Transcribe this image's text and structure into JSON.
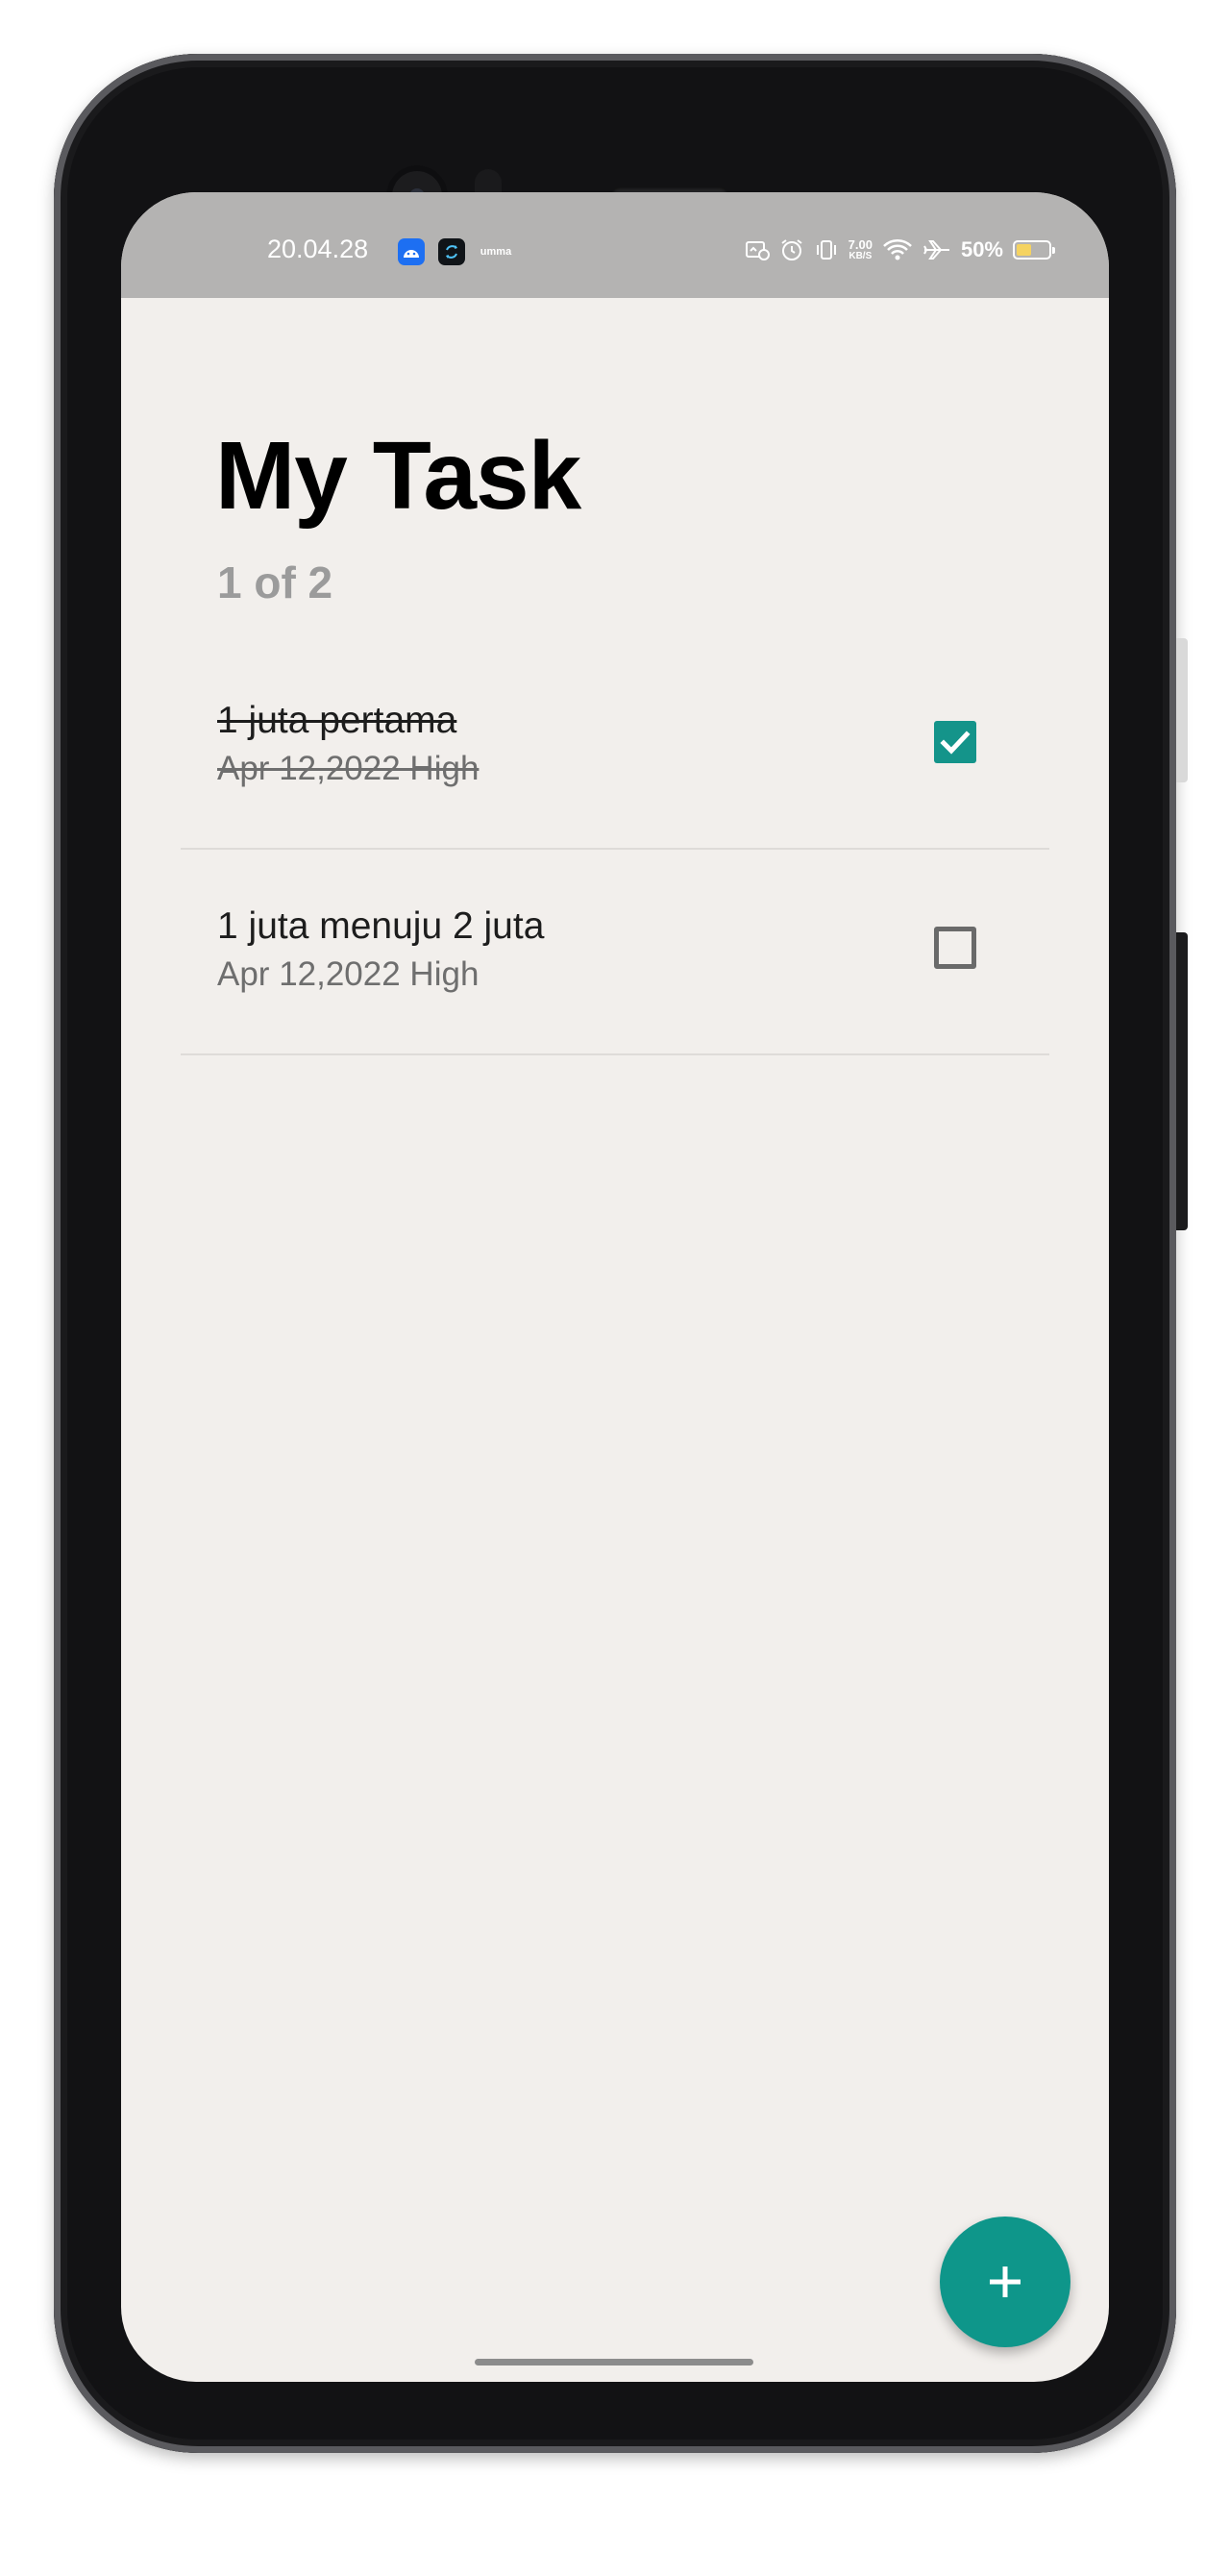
{
  "status_bar": {
    "time": "20.04.28",
    "notification_icons": [
      "android-app-icon",
      "sync-app-icon",
      "ummai-app-icon"
    ],
    "third_app_text": "umma",
    "network_speed_value": "7.00",
    "network_speed_unit": "KB/S",
    "battery_percent": "50%",
    "battery_level": 0.5,
    "system_icons": [
      "data-saver-icon",
      "alarm-icon",
      "vibrate-icon",
      "wifi-icon",
      "airplane-icon",
      "battery-icon"
    ]
  },
  "app": {
    "title": "My Task",
    "subtitle": "1 of 2",
    "tasks": [
      {
        "name": "1 juta pertama",
        "meta": "Apr 12,2022 High",
        "done": true
      },
      {
        "name": "1 juta menuju 2 juta",
        "meta": "Apr 12,2022 High",
        "done": false
      }
    ],
    "fab_icon": "plus-icon"
  },
  "colors": {
    "accent": "#0e968a",
    "background": "#f2efec",
    "status_bar": "#b4b3b2",
    "battery": "#f5d361"
  }
}
